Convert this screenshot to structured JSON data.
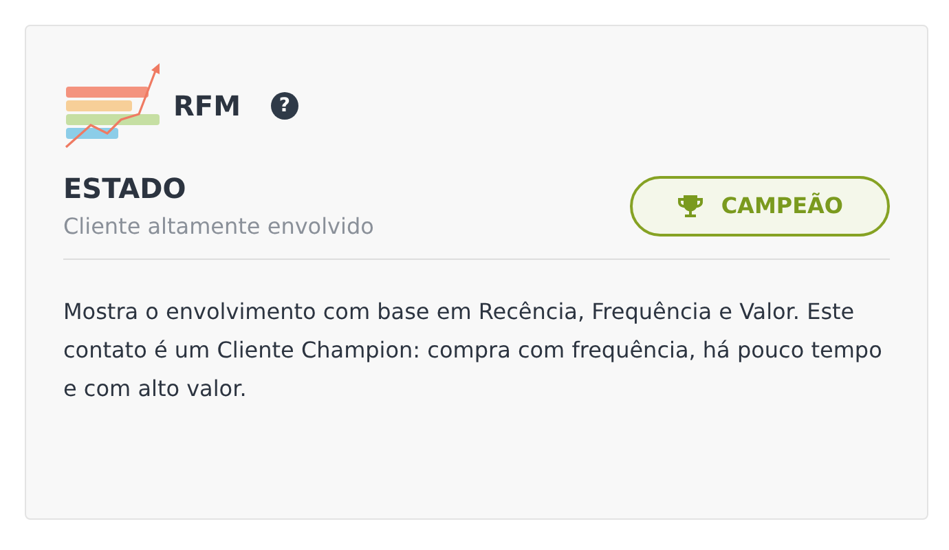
{
  "header": {
    "title": "RFM",
    "help": "?"
  },
  "status": {
    "label": "ESTADO",
    "description": "Cliente altamente envolvido",
    "badge": "CAMPEÃO"
  },
  "body": "Mostra o envolvimento com base em Recência, Frequência e Valor. Este contato é um Cliente Champion: compra com frequência, há pouco tempo e com alto valor."
}
